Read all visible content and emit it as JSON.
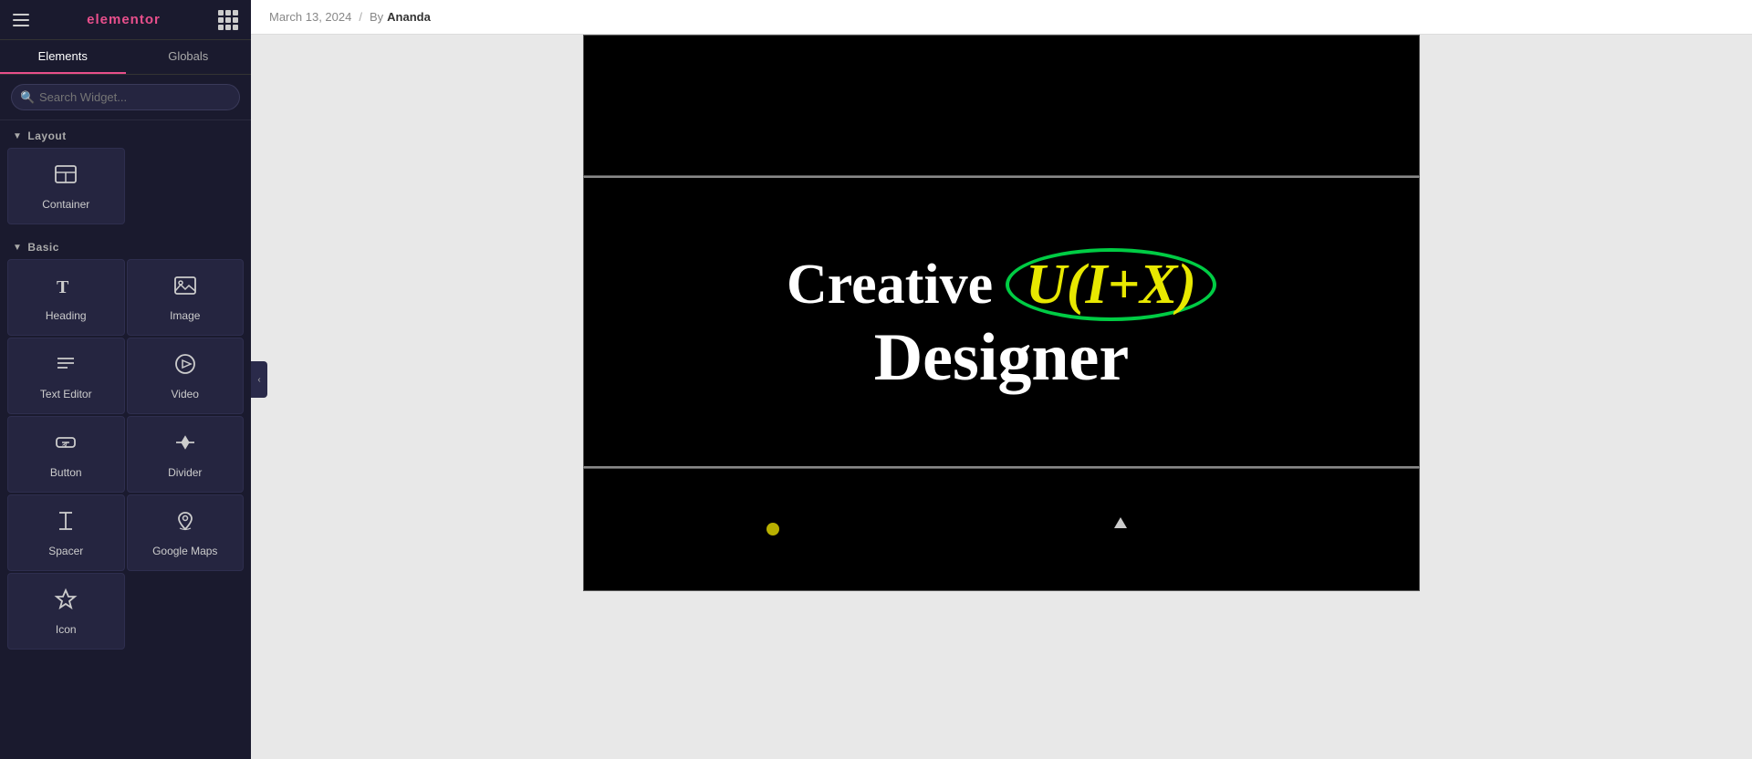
{
  "panel": {
    "logo": "elementor",
    "tabs": [
      {
        "label": "Elements",
        "active": true
      },
      {
        "label": "Globals",
        "active": false
      }
    ],
    "search_placeholder": "Search Widget...",
    "layout_section": {
      "label": "Layout",
      "items": [
        {
          "id": "container",
          "label": "Container",
          "icon": "container-icon"
        }
      ]
    },
    "basic_section": {
      "label": "Basic",
      "items": [
        {
          "id": "heading",
          "label": "Heading",
          "icon": "heading-icon"
        },
        {
          "id": "image",
          "label": "Image",
          "icon": "image-icon"
        },
        {
          "id": "text-editor",
          "label": "Text Editor",
          "icon": "text-editor-icon"
        },
        {
          "id": "video",
          "label": "Video",
          "icon": "video-icon"
        },
        {
          "id": "button",
          "label": "Button",
          "icon": "button-icon"
        },
        {
          "id": "divider",
          "label": "Divider",
          "icon": "divider-icon"
        },
        {
          "id": "spacer",
          "label": "Spacer",
          "icon": "spacer-icon"
        },
        {
          "id": "google-maps",
          "label": "Google Maps",
          "icon": "google-maps-icon"
        },
        {
          "id": "icon",
          "label": "Icon",
          "icon": "icon-icon"
        }
      ]
    }
  },
  "meta": {
    "date": "March 13, 2024",
    "separator": "/",
    "by_label": "By",
    "author": "Ananda"
  },
  "hero": {
    "line1_text": "Creative",
    "badge_text": "U(I+X)",
    "line2_text": "Designer"
  },
  "colors": {
    "badge_border": "#00cc44",
    "badge_text": "#e8e800",
    "hero_text": "#ffffff",
    "dot_color": "#b8b000"
  }
}
